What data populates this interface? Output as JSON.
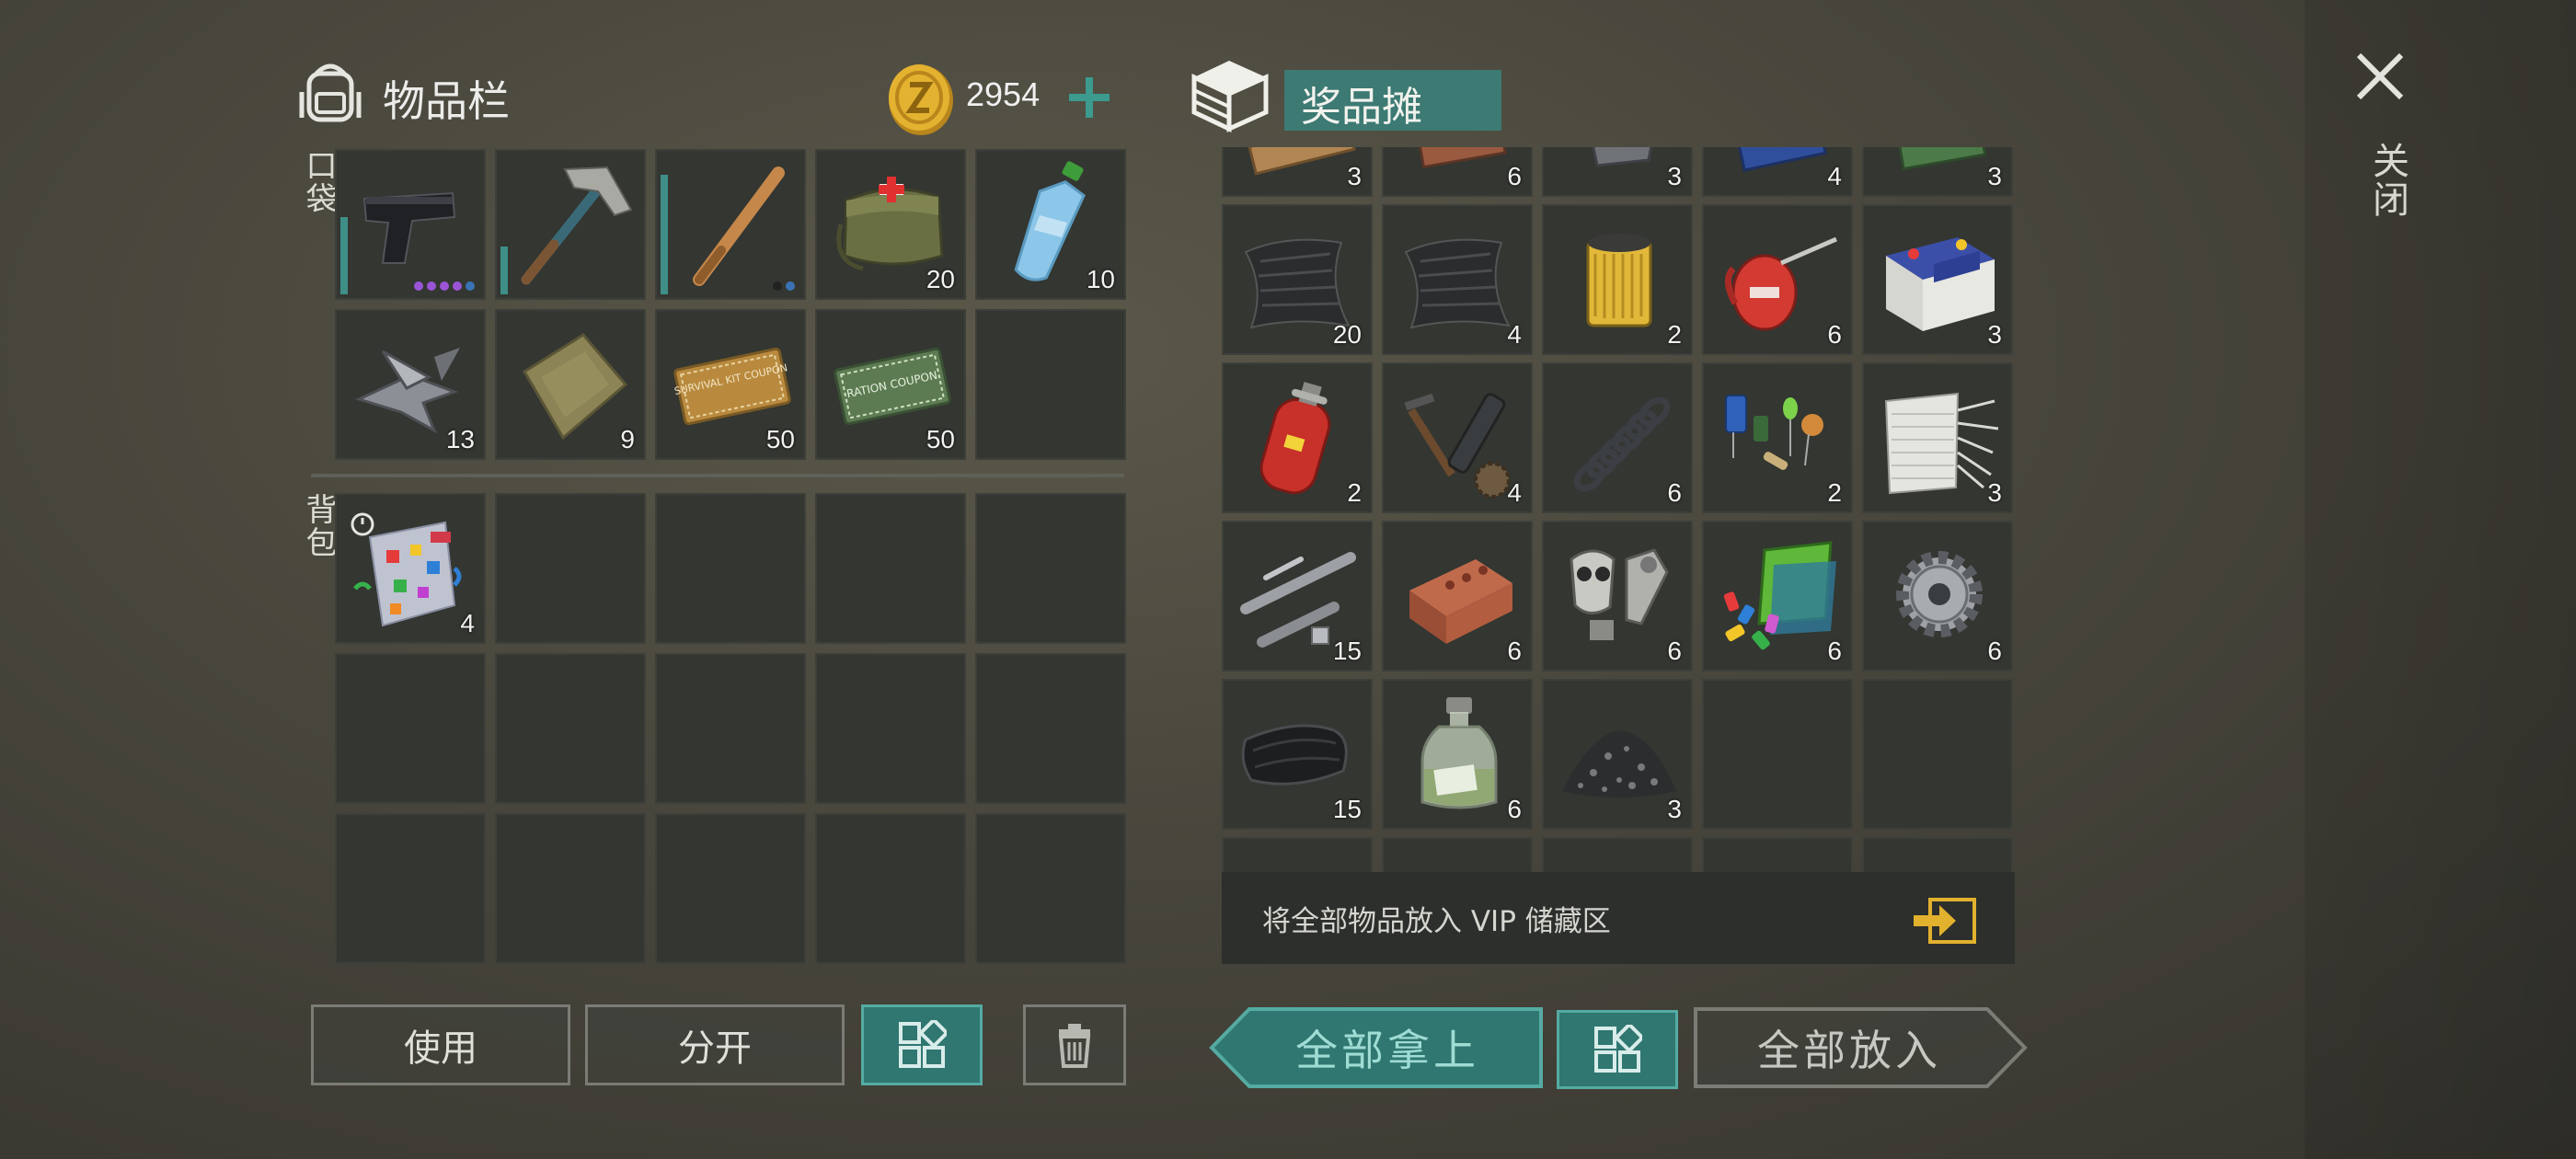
{
  "inventory": {
    "title": "物品栏",
    "coins": "2954",
    "pocket_label": "口袋",
    "backpack_label": "背包",
    "pocket_items": [
      {
        "icon": "pistol-icon",
        "qty": ""
      },
      {
        "icon": "hammer-icon",
        "qty": ""
      },
      {
        "icon": "baseball-bat-icon",
        "qty": ""
      },
      {
        "icon": "first-aid-bag-icon",
        "qty": "20"
      },
      {
        "icon": "water-bottle-icon",
        "qty": "10"
      },
      {
        "icon": "metal-scraps-icon",
        "qty": "13"
      },
      {
        "icon": "cloth-icon",
        "qty": "9"
      },
      {
        "icon": "survival-kit-coupon-icon",
        "qty": "50"
      },
      {
        "icon": "ration-coupon-icon",
        "qty": "50"
      },
      {
        "icon": "",
        "qty": ""
      }
    ],
    "backpack_items": [
      {
        "icon": "confetti-bag-icon",
        "qty": "4"
      }
    ],
    "coupon_texts": {
      "survival": "SURVIVAL KIT COUPON",
      "ration": "RATION COUPON"
    },
    "buttons": {
      "use": "使用",
      "split": "分开"
    }
  },
  "booth": {
    "title": "奖品摊",
    "items": [
      {
        "icon": "planks-icon",
        "qty": "3"
      },
      {
        "icon": "bricks-top-icon",
        "qty": "6"
      },
      {
        "icon": "metal-part-icon",
        "qty": "3"
      },
      {
        "icon": "circuit-board-icon",
        "qty": "4"
      },
      {
        "icon": "chip-icon",
        "qty": "3"
      },
      {
        "icon": "rubber-sheet-icon",
        "qty": "20"
      },
      {
        "icon": "rubber-sheet-icon",
        "qty": "4"
      },
      {
        "icon": "oil-filter-icon",
        "qty": "2"
      },
      {
        "icon": "oil-can-icon",
        "qty": "6"
      },
      {
        "icon": "car-battery-icon",
        "qty": "3"
      },
      {
        "icon": "gas-cylinder-icon",
        "qty": "2"
      },
      {
        "icon": "gear-parts-icon",
        "qty": "4"
      },
      {
        "icon": "spring-icon",
        "qty": "6"
      },
      {
        "icon": "electronic-components-icon",
        "qty": "2"
      },
      {
        "icon": "fiberglass-icon",
        "qty": "3"
      },
      {
        "icon": "pipes-icon",
        "qty": "15"
      },
      {
        "icon": "brick-icon",
        "qty": "6"
      },
      {
        "icon": "gas-mask-parts-icon",
        "qty": "6"
      },
      {
        "icon": "plastic-parts-icon",
        "qty": "6"
      },
      {
        "icon": "cogwheel-icon",
        "qty": "6"
      },
      {
        "icon": "leather-icon",
        "qty": "15"
      },
      {
        "icon": "chemical-bottle-icon",
        "qty": "6"
      },
      {
        "icon": "gravel-icon",
        "qty": "3"
      },
      {
        "icon": "",
        "qty": ""
      },
      {
        "icon": "",
        "qty": ""
      },
      {
        "icon": "",
        "qty": ""
      },
      {
        "icon": "",
        "qty": ""
      },
      {
        "icon": "",
        "qty": ""
      },
      {
        "icon": "",
        "qty": ""
      },
      {
        "icon": "",
        "qty": ""
      }
    ],
    "vip_text": "将全部物品放入 VIP 储藏区",
    "take_all": "全部拿上",
    "put_all": "全部放入"
  },
  "close_label": "关闭",
  "colors": {
    "accent": "#3c7a73",
    "coin": "#e3b230",
    "slot": "#333631"
  }
}
